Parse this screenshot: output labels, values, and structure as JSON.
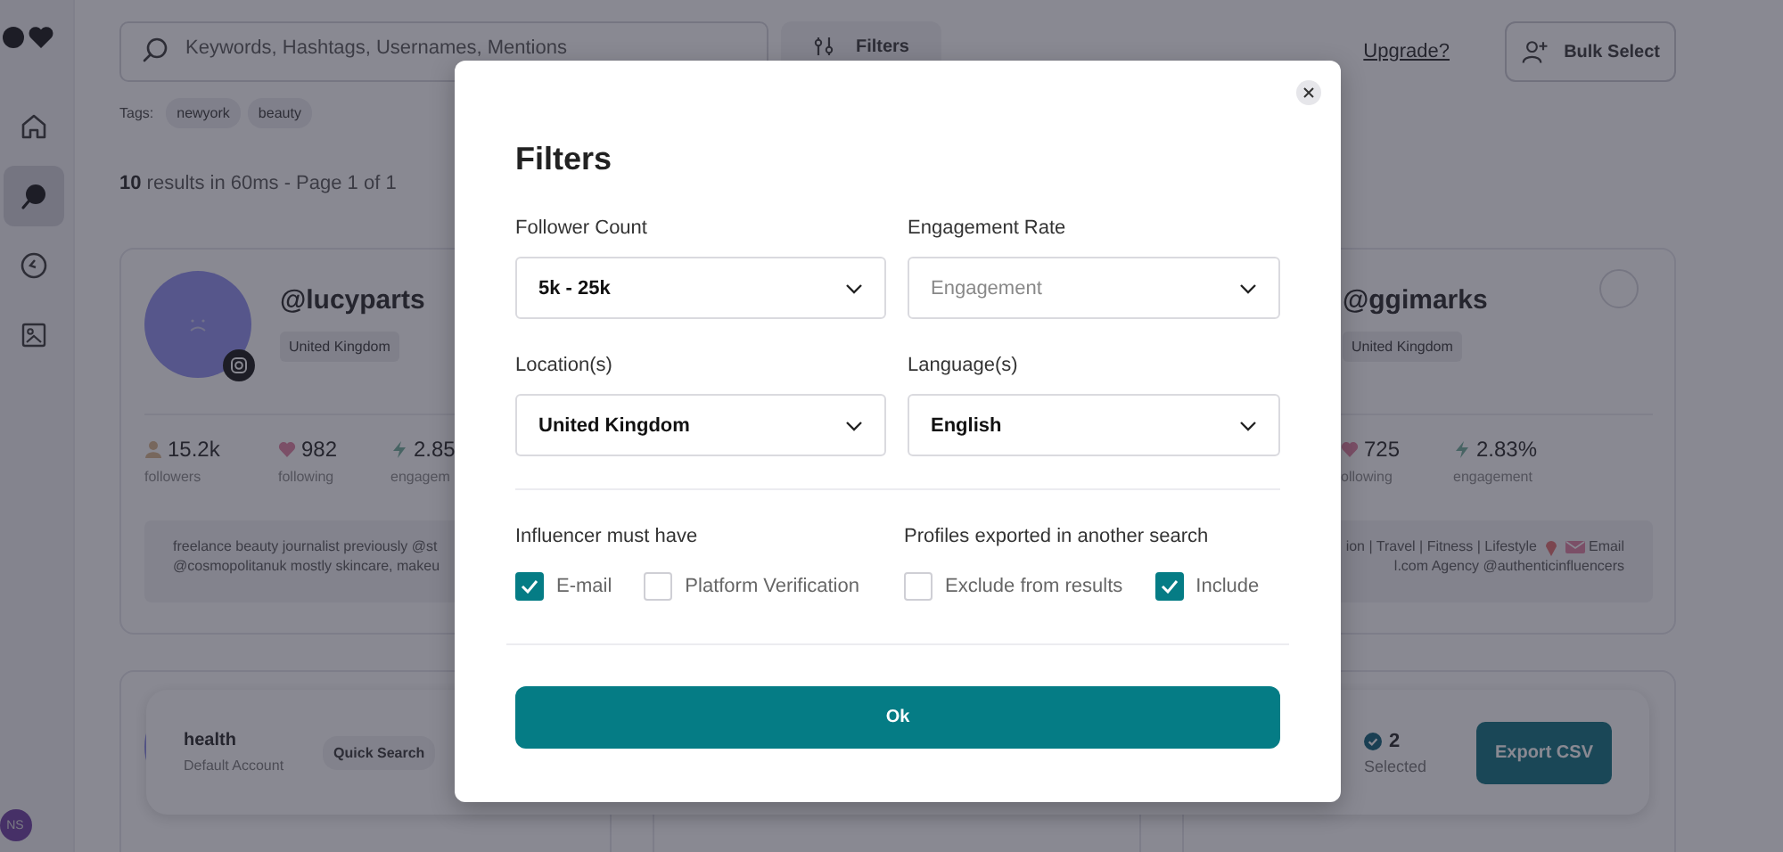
{
  "sidebar": {
    "items": [
      {
        "kind": "home",
        "selected": false
      },
      {
        "kind": "search",
        "selected": true
      },
      {
        "kind": "history",
        "selected": false
      },
      {
        "kind": "image",
        "selected": false
      }
    ],
    "user_initials": "NS"
  },
  "search": {
    "placeholder": "Keywords, Hashtags, Usernames, Mentions"
  },
  "filters_button": "Filters",
  "upgrade_link": "Upgrade?",
  "bulk_select_button": "Bulk Select",
  "tags": {
    "label": "Tags:",
    "items": [
      "newyork",
      "beauty"
    ]
  },
  "results_summary": "**10** results in 60ms - Page 1 of 1",
  "profiles": [
    {
      "handle": "@lucyparts",
      "location": "United Kingdom",
      "avatar": {
        "kind": "picture"
      },
      "stats": [
        {
          "kind": "followers",
          "value": "15.2k",
          "label": "followers"
        },
        {
          "kind": "following",
          "value": "982",
          "label": "following"
        },
        {
          "kind": "engagement",
          "value": "2.85",
          "label": "engagem"
        }
      ],
      "bio": [
        [
          {
            "kind": "text",
            "text": "freelance beauty journalist previously @st"
          }
        ],
        [
          {
            "kind": "text",
            "text": "@cosmopolitanuk mostly skincare, makeu"
          }
        ]
      ]
    },
    {
      "handle": "@ggimarks",
      "location": "United Kingdom",
      "selected": false,
      "stats": [
        {
          "kind": "following",
          "value": "725",
          "label": "ollowing"
        },
        {
          "kind": "engagement",
          "value": "2.83%",
          "label": "engagement"
        }
      ],
      "bio": [
        [
          {
            "kind": "text",
            "text": "ion | Travel | Fitness | Lifestyle"
          },
          {
            "kind": "pin"
          },
          {
            "kind": "envelope"
          },
          {
            "kind": "text",
            "text": "Email"
          }
        ],
        [
          {
            "kind": "text",
            "text": "l.com Agency @authenticinfluencers"
          }
        ]
      ]
    }
  ],
  "selection_bar": {
    "search_name": "health",
    "account": "Default Account",
    "quick_search": "Quick Search",
    "selected_count": "2",
    "selected_label": "Selected",
    "export_button": "Export CSV"
  },
  "modal": {
    "title": "Filters",
    "fields": [
      {
        "label": "Follower Count",
        "value": "5k - 25k"
      },
      {
        "label": "Engagement Rate",
        "placeholder": "Engagement"
      },
      {
        "label": "Location(s)",
        "value": "United Kingdom"
      },
      {
        "label": "Language(s)",
        "value": "English"
      }
    ],
    "groups": [
      {
        "label": "Influencer must have",
        "options": [
          {
            "label": "E-mail",
            "checked": true
          },
          {
            "label": "Platform Verification",
            "checked": false
          }
        ]
      },
      {
        "label": "Profiles exported in another search",
        "options": [
          {
            "label": "Exclude from results",
            "checked": false
          },
          {
            "label": "Include",
            "checked": true
          }
        ]
      }
    ],
    "ok_button": "Ok"
  }
}
